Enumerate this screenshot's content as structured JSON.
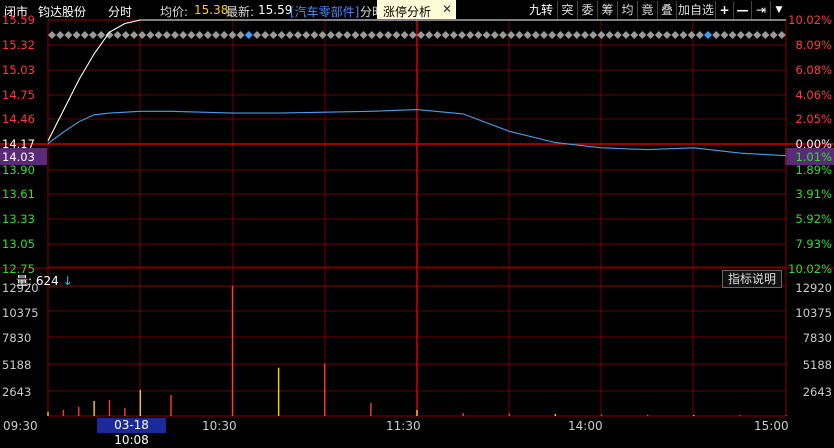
{
  "header": {
    "status": "闭市",
    "name": "钧达股份",
    "chart_type": "分时",
    "avg_label": "均价:",
    "avg_value": "15.38",
    "last_label": "最新:",
    "last_value": "15.59",
    "sector": "[汽车零部件]",
    "sector_cut": "分时",
    "tag": "涨停分析",
    "tag_close": "✕"
  },
  "toolbar": [
    "九转",
    "突",
    "委",
    "筹",
    "均",
    "竟",
    "叠",
    "加自选",
    "+",
    "—",
    "⇥",
    "▼"
  ],
  "price_axis_left": [
    "15.59",
    "15.32",
    "15.03",
    "14.75",
    "14.46",
    "14.17",
    "14.03",
    "13.90",
    "13.61",
    "13.33",
    "13.05",
    "12.75"
  ],
  "pct_axis_right": [
    "10.02%",
    "8.09%",
    "6.08%",
    "4.06%",
    "2.05%",
    "0.00%",
    "1.01%",
    "1.89%",
    "3.91%",
    "5.92%",
    "7.93%",
    "10.02%"
  ],
  "volume_title_label": "量:",
  "volume_title_value": "624",
  "volume_arrow": "↓",
  "volume_axis": [
    "12920",
    "10375",
    "7830",
    "5188",
    "2643"
  ],
  "indicator_button": "指标说明",
  "time_axis": [
    "09:30",
    "10:30",
    "11:30",
    "14:00",
    "15:00"
  ],
  "cursor_time": "03-18 10:08",
  "colors": {
    "up": "#ff3b3b",
    "down": "#33dd33",
    "grid": "#8b0000",
    "avg_line": "#4aa0e8",
    "price_line": "#ffffff",
    "accent": "#00d0ff"
  },
  "chart_data": {
    "type": "line",
    "x": [
      "09:30",
      "09:35",
      "09:40",
      "09:45",
      "09:50",
      "09:55",
      "10:00",
      "10:10",
      "10:30",
      "10:45",
      "11:00",
      "11:15",
      "11:30",
      "13:15",
      "13:30",
      "13:45",
      "14:00",
      "14:15",
      "14:30",
      "14:45",
      "15:00"
    ],
    "series": [
      {
        "name": "均价",
        "values": [
          14.17,
          14.3,
          14.42,
          14.5,
          14.52,
          14.53,
          14.54,
          14.54,
          14.52,
          14.52,
          14.53,
          14.54,
          14.56,
          14.51,
          14.31,
          14.18,
          14.12,
          14.1,
          14.12,
          14.06,
          14.03
        ]
      },
      {
        "name": "最新",
        "values": [
          14.2,
          14.55,
          14.9,
          15.2,
          15.45,
          15.55,
          15.59,
          15.59,
          15.59,
          15.59,
          15.59,
          15.59,
          15.59,
          15.59,
          15.59,
          15.59,
          15.59,
          15.59,
          15.59,
          15.59,
          15.59
        ]
      }
    ],
    "volume": [
      420,
      600,
      900,
      1500,
      1600,
      800,
      2600,
      2100,
      12920,
      4800,
      5200,
      1300,
      600,
      300,
      250,
      200,
      150,
      120,
      100,
      90,
      80
    ],
    "ylim": [
      12.75,
      15.59
    ]
  }
}
